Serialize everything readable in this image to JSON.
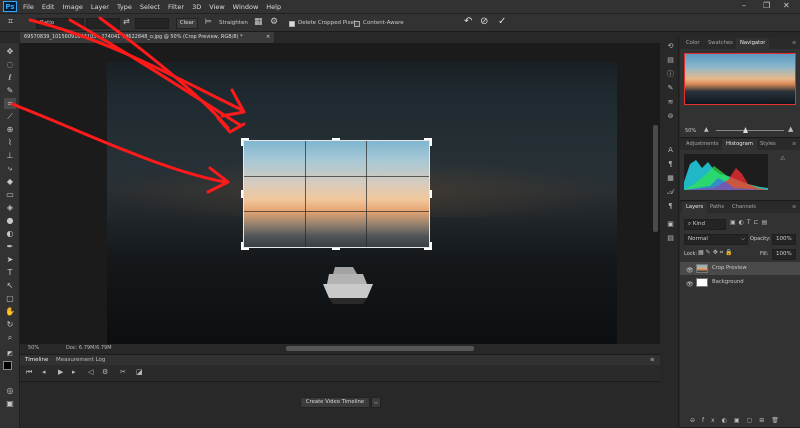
{
  "menu": [
    "File",
    "Edit",
    "Image",
    "Layer",
    "Type",
    "Select",
    "Filter",
    "3D",
    "View",
    "Window",
    "Help"
  ],
  "app_icon": "Ps",
  "window_controls": [
    "–",
    "❐",
    "✕"
  ],
  "options": {
    "ratio": "Ratio",
    "swap_icon": "⇄",
    "clear": "Clear",
    "straighten": "Straighten",
    "delete_cropped": "Delete Cropped Pixels",
    "content_aware": "Content-Aware",
    "delete_cropped_checked": true,
    "content_aware_checked": false
  },
  "document": {
    "tab": "69570839_10156091664105...274041   73622848_o.jpg @ 50% (Crop Preview, RGB/8) *",
    "close": "×"
  },
  "status": {
    "zoom": "50%",
    "doc": "Doc: 6.79M/6.79M"
  },
  "timeline": {
    "tabs": [
      "Timeline",
      "Measurement Log"
    ],
    "create_button": "Create Video Timeline",
    "dropdown_glyph": "⌵"
  },
  "panels": {
    "top_tabs": [
      "Color",
      "Swatches",
      "Navigator"
    ],
    "nav_zoom": "50%",
    "mid_tabs": [
      "Adjustments",
      "Histogram",
      "Styles"
    ],
    "layer_tabs": [
      "Layers",
      "Paths",
      "Channels"
    ],
    "kind": "Kind",
    "blend": "Normal",
    "opacity_label": "Opacity:",
    "opacity": "100%",
    "lock_label": "Lock:",
    "fill_label": "Fill:",
    "fill": "100%",
    "layers": [
      {
        "name": "Crop Preview",
        "selected": true
      },
      {
        "name": "Background",
        "selected": false
      }
    ]
  },
  "colors": {
    "accent": "#31a8ff",
    "nav_frame": "#e63030",
    "annotation": "#ff1a1a"
  }
}
